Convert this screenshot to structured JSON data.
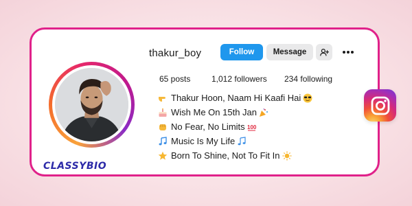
{
  "profile": {
    "username": "thakur_boy",
    "follow_label": "Follow",
    "message_label": "Message",
    "posts": "65 posts",
    "followers": "1,012 followers",
    "following": "234 following"
  },
  "bio": [
    {
      "text": "Thakur Hoon, Naam Hi Kaafi Hai",
      "lead_icon": "pointing-hand-icon",
      "trail_icon": "sunglasses-face-icon"
    },
    {
      "text": "Wish Me On 15th Jan",
      "lead_icon": "birthday-cake-icon",
      "trail_icon": "party-popper-icon"
    },
    {
      "text": "No Fear, No Limits",
      "lead_icon": "fist-bump-icon",
      "trail_icon": "hundred-points-icon"
    },
    {
      "text": "Music Is My Life",
      "lead_icon": "music-note-icon",
      "trail_icon": "music-notes-icon"
    },
    {
      "text": "Born To Shine, Not To Fit In",
      "lead_icon": "star-icon",
      "trail_icon": "sun-icon"
    }
  ],
  "branding": {
    "watermark": "CLASSYBIO"
  },
  "colors": {
    "card_border": "#e0218a",
    "follow_button": "#1f97ed",
    "message_button": "#e9e9ea",
    "brand_text": "#2c2aa8"
  }
}
